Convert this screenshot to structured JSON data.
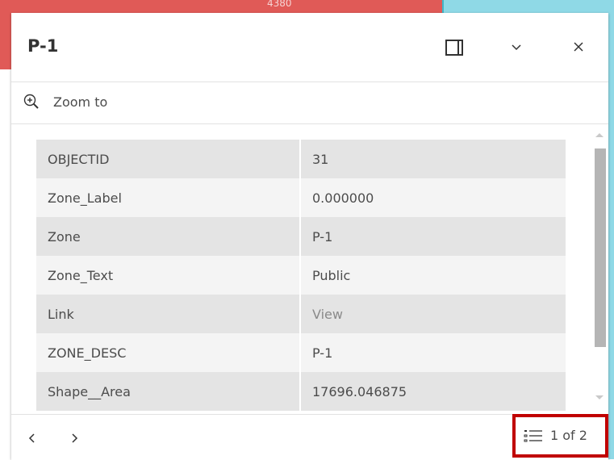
{
  "map": {
    "label": "4380",
    "colors": {
      "red_zone": "#e05a57",
      "cyan_zone": "#8fd9e6"
    }
  },
  "popup": {
    "title": "P-1",
    "icons": {
      "dock": "dock-icon",
      "collapse": "chevron-down-icon",
      "close": "close-icon"
    },
    "zoom_to_label": "Zoom to",
    "attributes": [
      {
        "key": "OBJECTID",
        "value": "31"
      },
      {
        "key": "Zone_Label",
        "value": "0.000000"
      },
      {
        "key": "Zone",
        "value": "P-1"
      },
      {
        "key": "Zone_Text",
        "value": "Public"
      },
      {
        "key": "Link",
        "value": "View"
      },
      {
        "key": "ZONE_DESC",
        "value": "P-1"
      },
      {
        "key": "Shape__Area",
        "value": "17696.046875"
      }
    ],
    "pagination": {
      "text": "1 of 2",
      "highlight_color": "#c00000"
    }
  }
}
